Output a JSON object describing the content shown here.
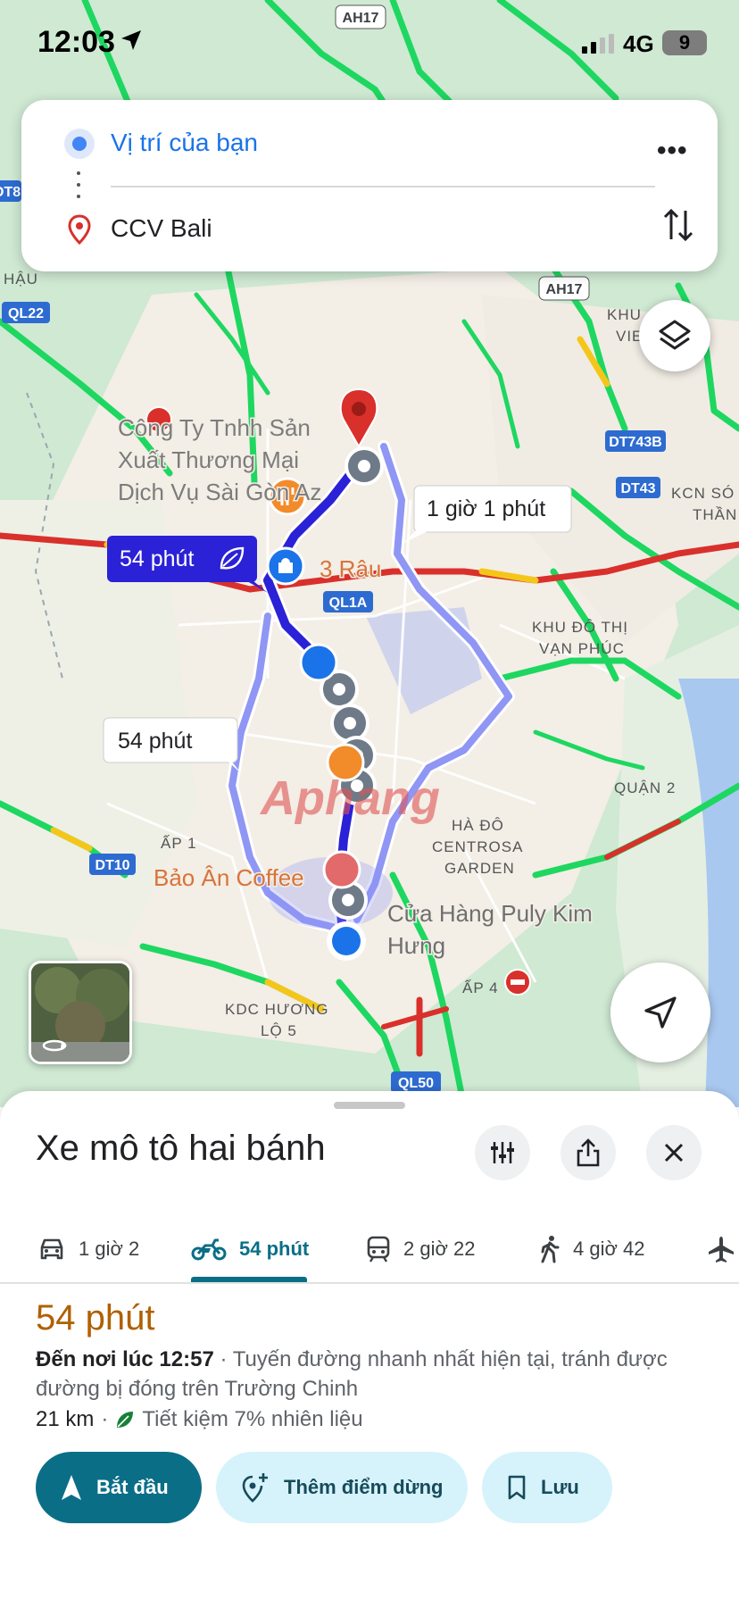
{
  "status_bar": {
    "time": "12:03",
    "network": "4G",
    "battery": "9"
  },
  "search": {
    "origin": "Vị trí của bạn",
    "destination": "CCV Bali"
  },
  "map": {
    "shields": [
      "AH17",
      "AH17",
      "QL22",
      "DT743B",
      "DT43",
      "QL1A",
      "DT10",
      "QL50",
      "DT8"
    ],
    "place_labels": {
      "company": [
        "Công Ty Tnhh Sản",
        "Xuất Thương Mại",
        "Dịch Vụ Sài Gòn Az"
      ],
      "restaurant": "3 Râu",
      "cafe": "Bảo Ân Coffee",
      "shop": [
        "Cửa Hàng Puly Kim",
        "Hưng"
      ],
      "khu_do_thi": [
        "KHU ĐÔ THỊ",
        "VẠN PHÚC"
      ],
      "ha_do": [
        "HÀ ĐÔ",
        "CENTROSA",
        "GARDEN"
      ],
      "quan2": "QUẬN 2",
      "ap1": "ẤP 1",
      "ap4": "ẤP 4",
      "kdc": [
        "KDC HƯƠNG",
        "LỘ 5"
      ],
      "kcn": [
        "KCN SÓ",
        "THẦN"
      ],
      "khu_vie": [
        "KHU",
        "VIE"
      ],
      "hau": "HẬU"
    },
    "callouts": {
      "alt1": "1 giờ 1 phút",
      "selected": "54 phút",
      "alt2": "54 phút"
    },
    "watermark": "Aphang"
  },
  "sheet": {
    "title": "Xe mô tô hai bánh",
    "modes": [
      {
        "icon": "car-icon",
        "label": "1 giờ 2"
      },
      {
        "icon": "motorbike-icon",
        "label": "54 phút"
      },
      {
        "icon": "transit-icon",
        "label": "2 giờ 22"
      },
      {
        "icon": "walk-icon",
        "label": "4 giờ 42"
      },
      {
        "icon": "plane-icon",
        "label": ""
      }
    ],
    "duration": "54 phút",
    "arrival_bold": "Đến nơi lúc 12:57",
    "arrival_rest": " · Tuyến đường nhanh nhất hiện tại, tránh được đường bị đóng trên Trường Chinh",
    "distance": "21 km",
    "fuel": "Tiết kiệm 7% nhiên liệu",
    "actions": {
      "start": "Bắt đầu",
      "add_stop": "Thêm điểm dừng",
      "save": "Lưu"
    }
  },
  "colors": {
    "route_selected": "#2b21d6",
    "route_alt": "#8f96f4",
    "traffic_green": "#1ed760",
    "traffic_yellow": "#f5c61a",
    "traffic_red": "#d9302b",
    "accent": "#0b6e87",
    "duration": "#b06000"
  }
}
